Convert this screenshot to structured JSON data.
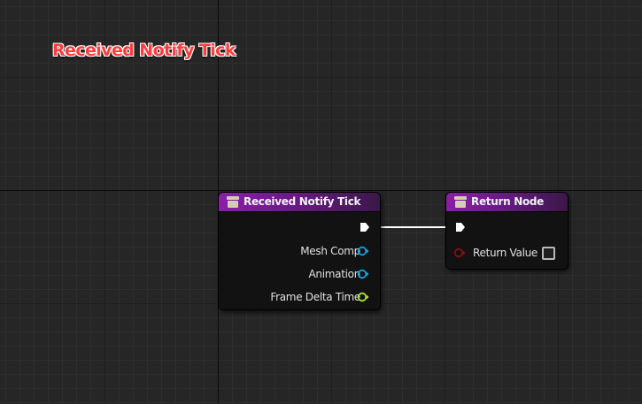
{
  "graph": {
    "comment_title": "Received Notify Tick"
  },
  "nodes": {
    "received_notify_tick": {
      "title": "Received Notify Tick",
      "outputs": [
        {
          "label": "Mesh Comp",
          "color": "#0fa0e8"
        },
        {
          "label": "Animation",
          "color": "#0fa0e8"
        },
        {
          "label": "Frame Delta Time",
          "color": "#a6e62c"
        }
      ]
    },
    "return_node": {
      "title": "Return Node",
      "inputs": [
        {
          "label": "Return Value",
          "color": "#8a0f0f"
        }
      ]
    }
  },
  "colors": {
    "header_gradient_start": "#8a1fa8",
    "node_body": "#121212",
    "exec_white": "#ffffff",
    "object_pin_blue": "#0fa0e8",
    "float_pin_green": "#a6e62c",
    "bool_pin_red": "#8a0f0f",
    "title_red": "#ff3c3c"
  }
}
